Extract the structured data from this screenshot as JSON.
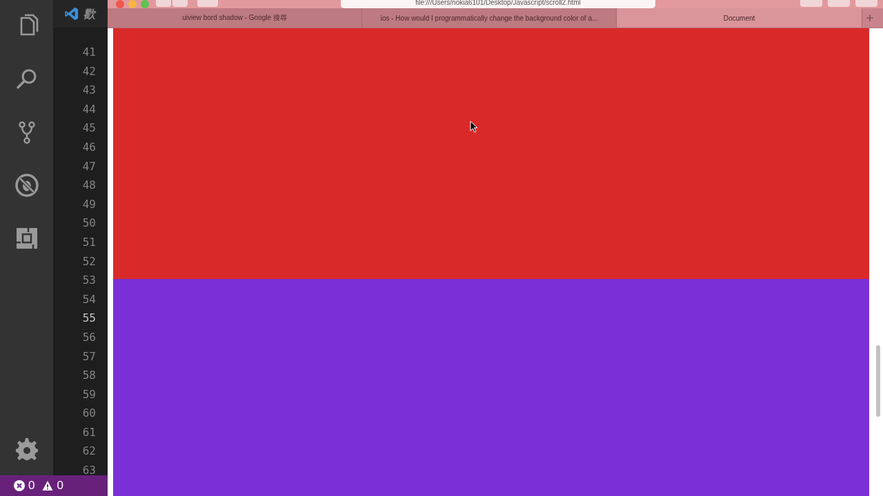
{
  "editor": {
    "tab_title": "歡",
    "line_numbers": [
      {
        "text": "41",
        "current": false
      },
      {
        "text": "42",
        "current": false
      },
      {
        "text": "43",
        "current": false
      },
      {
        "text": "44",
        "current": false
      },
      {
        "text": "45",
        "current": false
      },
      {
        "text": "46",
        "current": false
      },
      {
        "text": "47",
        "current": false
      },
      {
        "text": "48",
        "current": false
      },
      {
        "text": "49",
        "current": false
      },
      {
        "text": "50",
        "current": false
      },
      {
        "text": "51",
        "current": false
      },
      {
        "text": "52",
        "current": false
      },
      {
        "text": "53",
        "current": false
      },
      {
        "text": "54",
        "current": false
      },
      {
        "text": "55",
        "current": true
      },
      {
        "text": "56",
        "current": false
      },
      {
        "text": "57",
        "current": false
      },
      {
        "text": "58",
        "current": false
      },
      {
        "text": "59",
        "current": false
      },
      {
        "text": "60",
        "current": false
      },
      {
        "text": "61",
        "current": false
      },
      {
        "text": "62",
        "current": false
      },
      {
        "text": "63",
        "current": false
      }
    ]
  },
  "activity_bar": {
    "items": [
      {
        "kind": "files"
      },
      {
        "kind": "search"
      },
      {
        "kind": "git"
      },
      {
        "kind": "debug"
      },
      {
        "kind": "extensions"
      }
    ],
    "bottom": [
      {
        "kind": "settings"
      }
    ]
  },
  "status_bar": {
    "errors": "0",
    "warnings": "0"
  },
  "browser": {
    "address": "file:///Users/nokia6101/Desktop/Javascript/scroll2.html",
    "tabs": [
      {
        "label": "uiview bord shadow - Google 搜尋",
        "selected": false
      },
      {
        "label": "ios - How would I programmatically change the background color of a...",
        "selected": false
      },
      {
        "label": "Document",
        "selected": true
      }
    ],
    "page_sections": [
      {
        "color": "#d92a29"
      },
      {
        "color": "#7b2fd6"
      }
    ]
  }
}
